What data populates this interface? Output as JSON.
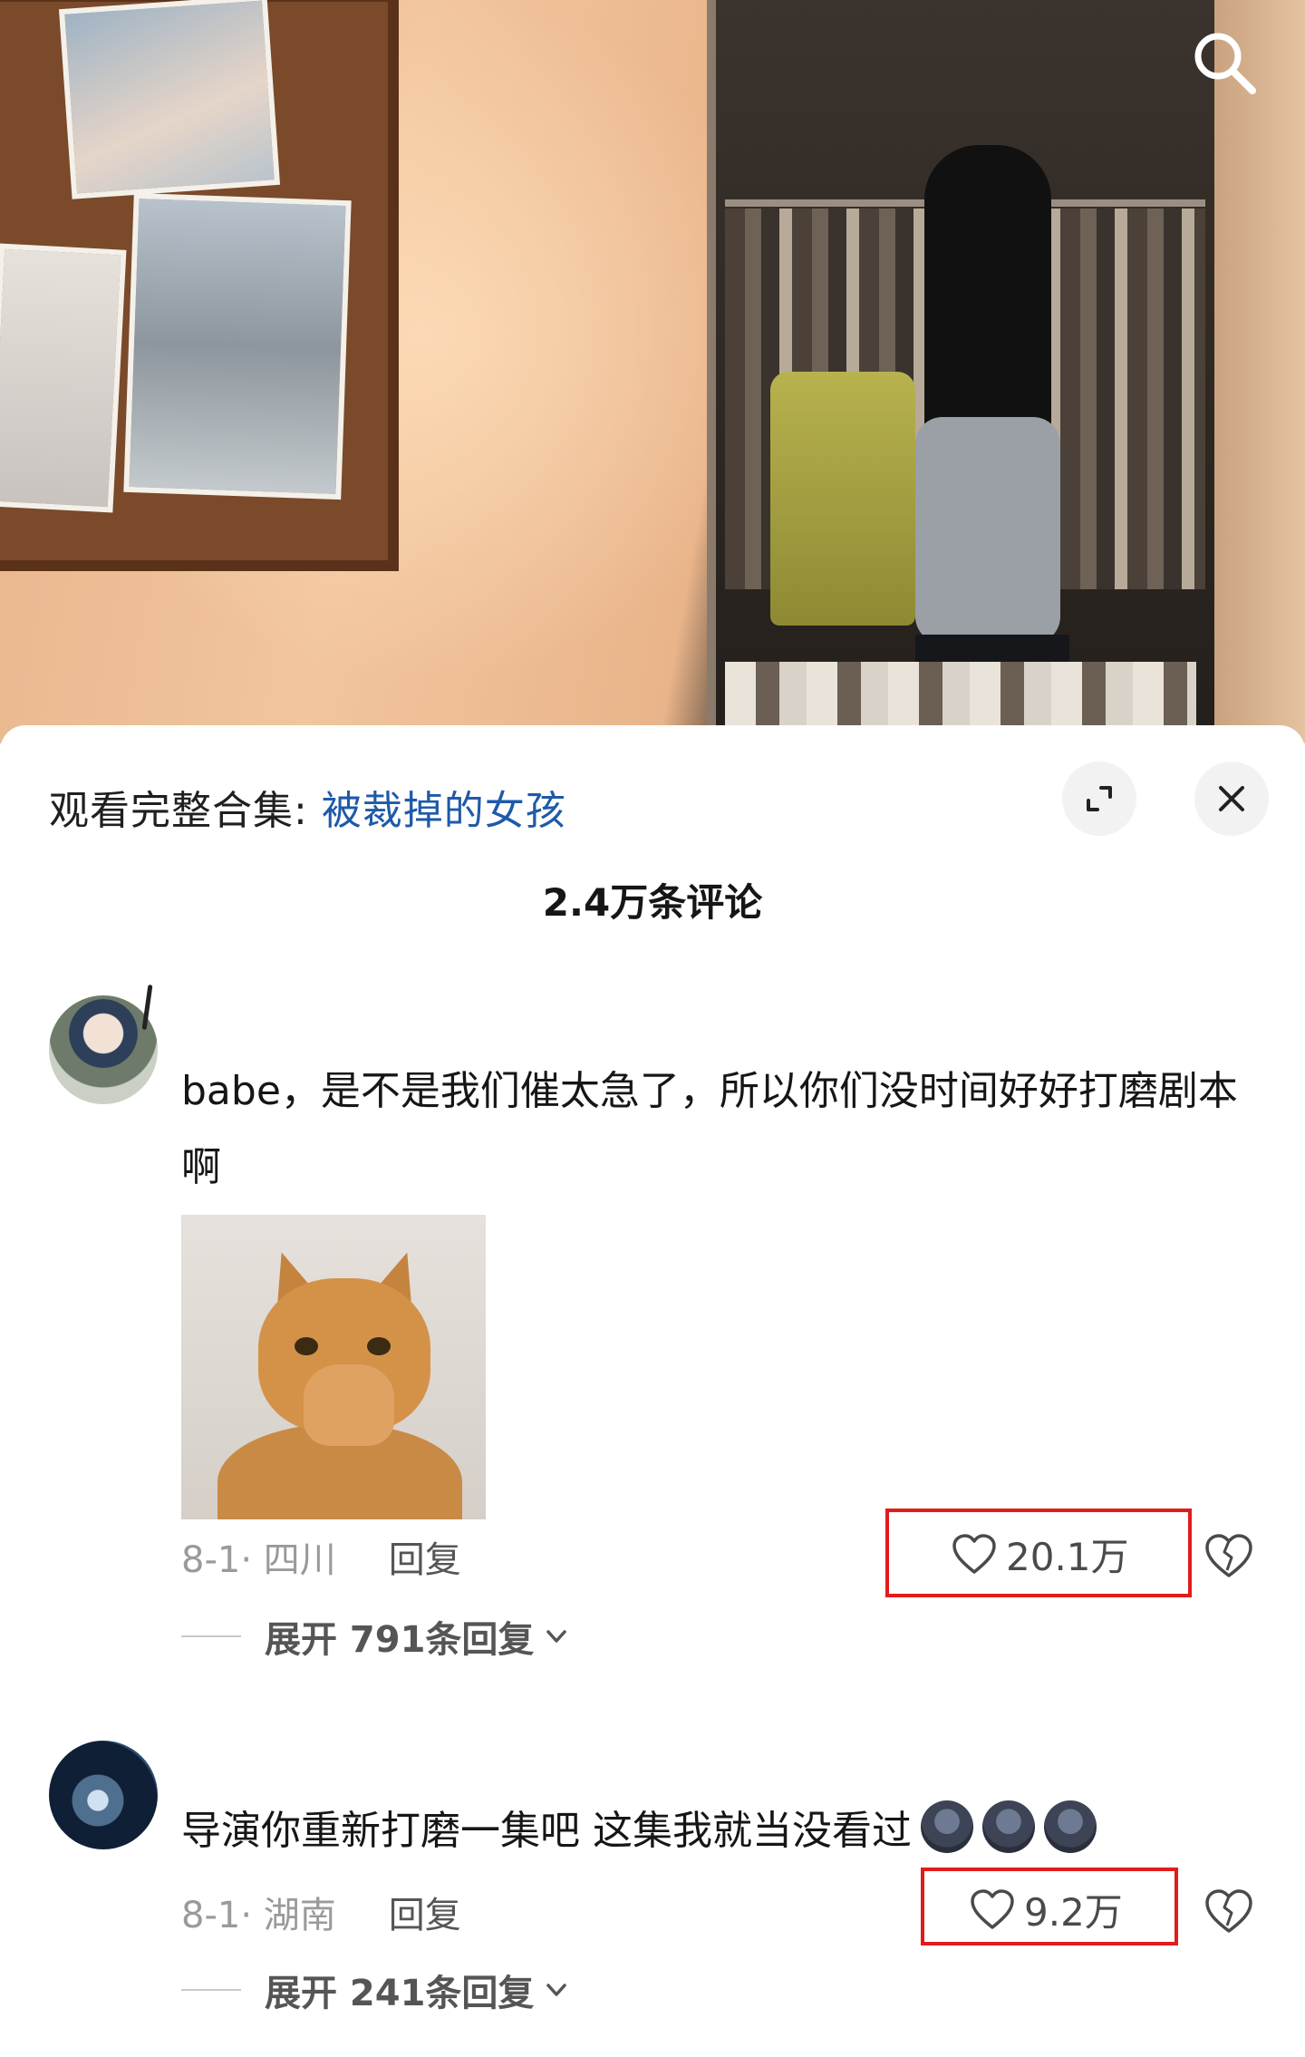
{
  "header": {
    "collection_prefix": "观看完整合集: ",
    "collection_name": "被裁掉的女孩",
    "comment_count_title": "2.4万条评论"
  },
  "comments": [
    {
      "text": "babe，是不是我们催太急了，所以你们没时间好好打磨剧本啊",
      "has_image": true,
      "date_location": "8-1· 四川",
      "reply_label": "回复",
      "likes": "20.1万",
      "expand_label": "展开 791条回复"
    },
    {
      "text": "导演你重新打磨一集吧 这集我就当没看过",
      "emoji_count": 3,
      "date_location": "8-1· 湖南",
      "reply_label": "回复",
      "likes": "9.2万",
      "expand_label": "展开 241条回复"
    }
  ],
  "colors": {
    "link": "#1e5aa8",
    "highlight_box": "#e21b1b",
    "meta_text": "#9a9a9a"
  },
  "icons": [
    "search-icon",
    "expand-icon",
    "close-icon",
    "heart-icon",
    "broken-heart-icon",
    "chevron-down-icon"
  ]
}
